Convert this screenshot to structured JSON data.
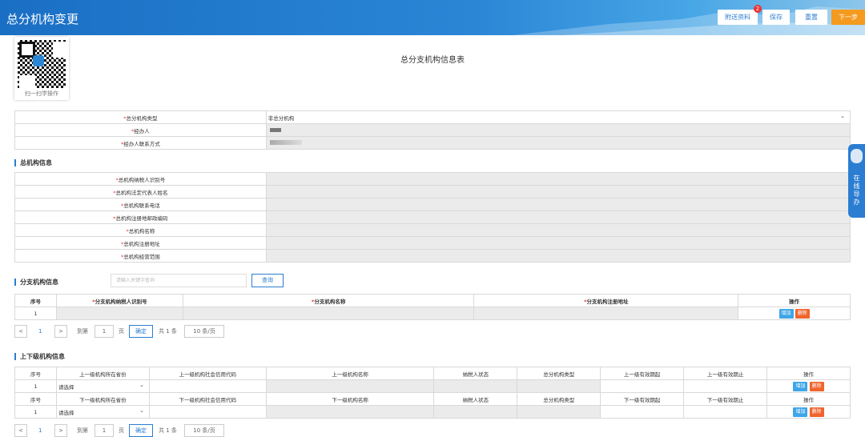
{
  "header": {
    "title": "总分机构变更",
    "btn_attach": "附送资料",
    "badge": "2",
    "btn_save": "保存",
    "btn_reset": "重置",
    "btn_next": "下一步"
  },
  "qr": {
    "caption": "扫一扫学操作"
  },
  "form_title": "总分支机构信息表",
  "basic": {
    "type_label": "总分机构类型",
    "type_value": "非总分机构",
    "handler_label": "经办人",
    "phone_label": "经办人联系方式"
  },
  "hq": {
    "section": "总机构信息",
    "fields": [
      "总机构纳税人识别号",
      "总机构法定代表人姓名",
      "总机构联系电话",
      "总机构注册地邮政编码",
      "总机构名称",
      "总机构注册地址",
      "总机构经营范围"
    ]
  },
  "branch": {
    "section": "分支机构信息",
    "search_placeholder": "请输入关键字查询",
    "search_btn": "查询",
    "cols": [
      "序号",
      "分支机构纳税人识别号",
      "分支机构名称",
      "分支机构注册地址",
      "操作"
    ],
    "row_no": "1",
    "add": "增加",
    "del": "删除"
  },
  "pager": {
    "page": "1",
    "goto": "到第",
    "page_unit": "页",
    "confirm": "确定",
    "total": "共 1 条",
    "per_page": "10 条/页"
  },
  "relations": {
    "section": "上下级机构信息",
    "up_cols": [
      "序号",
      "上一级机构所在省份",
      "上一级机构社会信用代码",
      "上一级机构名称",
      "纳税人状态",
      "总分机构类型",
      "上一级有效期起",
      "上一级有效期止",
      "操作"
    ],
    "down_cols": [
      "序号",
      "下一级机构所在省份",
      "下一级机构社会信用代码",
      "下一级机构名称",
      "纳税人状态",
      "总分机构类型",
      "下一级有效期起",
      "下一级有效期止",
      "操作"
    ],
    "row_no": "1",
    "select_placeholder": "请选择",
    "add": "增加",
    "del": "删除"
  },
  "online": {
    "text": "在线导办"
  }
}
